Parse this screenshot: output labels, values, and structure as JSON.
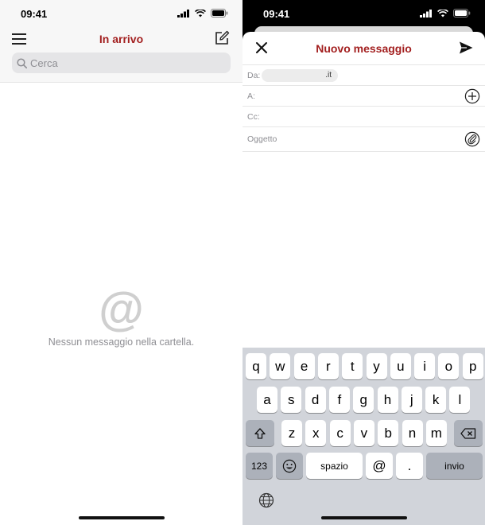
{
  "left_screen": {
    "status": {
      "time": "09:41"
    },
    "header": {
      "title": "In arrivo"
    },
    "search": {
      "placeholder": "Cerca"
    },
    "empty_state": {
      "symbol": "@",
      "message": "Nessun messaggio nella cartella."
    }
  },
  "right_screen": {
    "status": {
      "time": "09:41"
    },
    "compose": {
      "title": "Nuovo messaggio",
      "from_label": "Da:",
      "from_value": ".it",
      "to_label": "A:",
      "cc_label": "Cc:",
      "subject_placeholder": "Oggetto"
    },
    "keyboard": {
      "row1": [
        "q",
        "w",
        "e",
        "r",
        "t",
        "y",
        "u",
        "i",
        "o",
        "p"
      ],
      "row2": [
        "a",
        "s",
        "d",
        "f",
        "g",
        "h",
        "j",
        "k",
        "l"
      ],
      "row3": [
        "z",
        "x",
        "c",
        "v",
        "b",
        "n",
        "m"
      ],
      "numbers_key": "123",
      "space_key": "spazio",
      "at_key": "@",
      "dot_key": ".",
      "return_key": "invio"
    }
  },
  "colors": {
    "accent": "#a32020",
    "keyboard_bg": "#d1d4da",
    "placeholder": "#8e8e93"
  }
}
